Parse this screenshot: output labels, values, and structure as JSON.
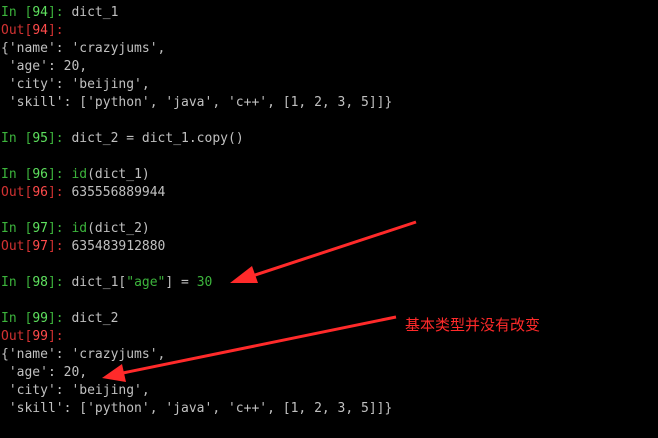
{
  "colors": {
    "background": "#000000",
    "prompt_in": "#3cb43c",
    "prompt_out": "#d23232",
    "text": "#c0c0c0",
    "annotation": "#ff2a2a"
  },
  "cells": {
    "c94": {
      "in_label": "In [",
      "in_num": "94",
      "in_close": "]: ",
      "code": "dict_1",
      "out_label": "Out[",
      "out_num": "94",
      "out_close": "]:",
      "output": [
        "{'name': 'crazyjums',",
        " 'age': 20,",
        " 'city': 'beijing',",
        " 'skill': ['python', 'java', 'c++', [1, 2, 3, 5]]}"
      ]
    },
    "c95": {
      "in_label": "In [",
      "in_num": "95",
      "in_close": "]: ",
      "code": "dict_2 = dict_1.copy()"
    },
    "c96": {
      "in_label": "In [",
      "in_num": "96",
      "in_close": "]: ",
      "func": "id",
      "args": "(dict_1)",
      "out_label": "Out[",
      "out_num": "96",
      "out_close": "]: ",
      "output": "635556889944"
    },
    "c97": {
      "in_label": "In [",
      "in_num": "97",
      "in_close": "]: ",
      "func": "id",
      "args": "(dict_2)",
      "out_label": "Out[",
      "out_num": "97",
      "out_close": "]: ",
      "output": "635483912880"
    },
    "c98": {
      "in_label": "In [",
      "in_num": "98",
      "in_close": "]: ",
      "code_pre": "dict_1[",
      "str": "\"age\"",
      "code_mid": "] = ",
      "value": "30"
    },
    "c99": {
      "in_label": "In [",
      "in_num": "99",
      "in_close": "]: ",
      "code": "dict_2",
      "out_label": "Out[",
      "out_num": "99",
      "out_close": "]:",
      "output": [
        "{'name': 'crazyjums',",
        " 'age': 20,",
        " 'city': 'beijing',",
        " 'skill': ['python', 'java', 'c++', [1, 2, 3, 5]]}"
      ]
    }
  },
  "annotation": {
    "text": "基本类型并没有改变"
  }
}
